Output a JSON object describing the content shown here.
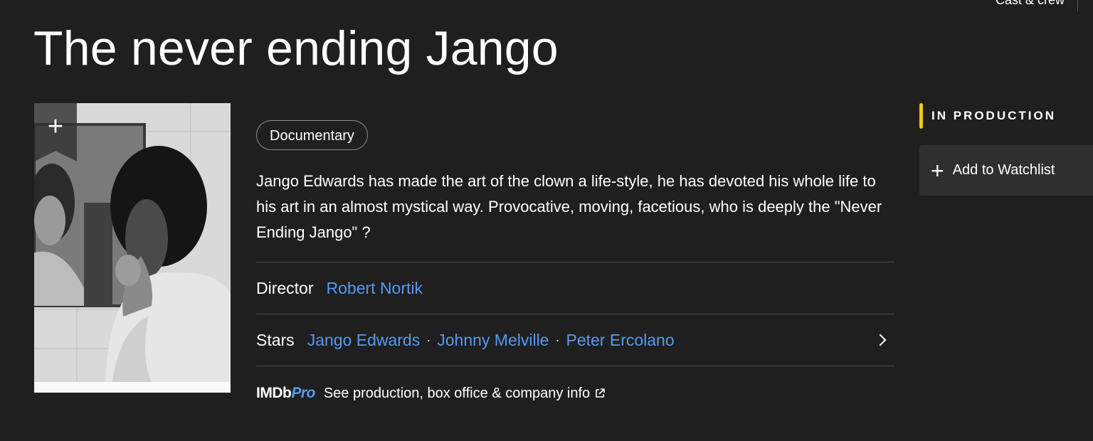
{
  "header": {
    "top_link": "Cast & crew",
    "title": "The never ending Jango"
  },
  "poster": {
    "add_icon": "plus-icon",
    "watchlist_ribbon_icon": "bookmark-ribbon-icon"
  },
  "main": {
    "genre": "Documentary",
    "plot": "Jango Edwards has made the art of the clown a life-style, he has devoted his whole life to his art in an almost mystical way. Provocative, moving, facetious, who is deeply the \"Never Ending Jango\" ?",
    "director": {
      "label": "Director",
      "names": [
        "Robert Nortik"
      ]
    },
    "stars": {
      "label": "Stars",
      "names": [
        "Jango Edwards",
        "Johnny Melville",
        "Peter Ercolano"
      ],
      "separator": "·",
      "more_icon": "chevron-right-icon"
    },
    "imdbpro": {
      "logo_imdb": "IMDb",
      "logo_pro": "Pro",
      "text": "See production, box office & company info",
      "icon": "external-link-icon"
    }
  },
  "sidebar": {
    "status": "IN PRODUCTION",
    "watchlist_label": "Add to Watchlist",
    "watchlist_icon": "plus-icon"
  },
  "colors": {
    "background": "#1f1f1f",
    "link": "#5799ef",
    "accent": "#f5c518",
    "button_bg": "#2f2f2f"
  }
}
